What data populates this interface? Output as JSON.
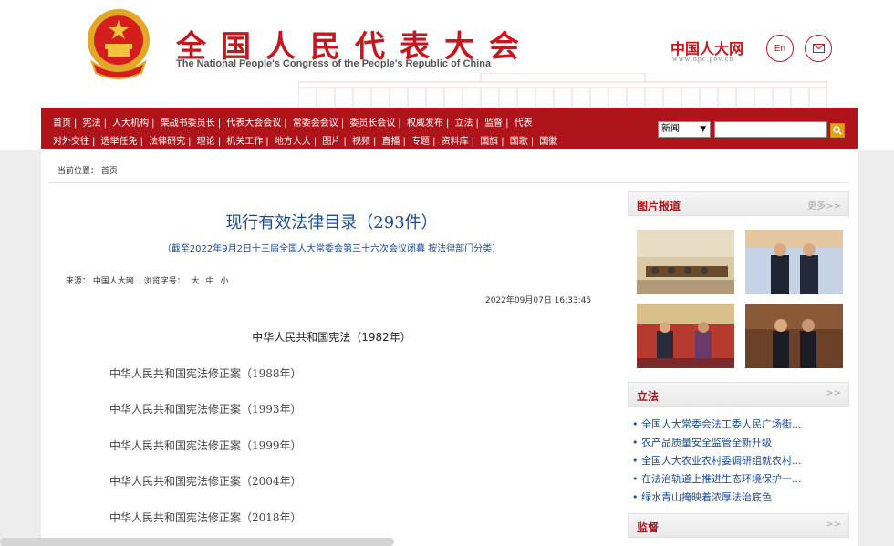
{
  "header": {
    "title_cn": "全国人民代表大会",
    "title_en": "The National People's Congress of the People's Republic of China",
    "npc_logo": "中国人大网",
    "npc_url": "www.npc.gov.cn",
    "en_button": "En",
    "mail_icon": "mail-icon"
  },
  "nav": {
    "row1": [
      "首页",
      "宪法",
      "人大机构",
      "栗战书委员长",
      "代表大会会议",
      "常委会会议",
      "委员长会议",
      "权威发布",
      "立法",
      "监督",
      "代表"
    ],
    "row2": [
      "对外交往",
      "选举任免",
      "法律研究",
      "理论",
      "机关工作",
      "地方人大",
      "图片",
      "视频",
      "直播",
      "专题",
      "资料库",
      "国旗",
      "国歌",
      "国徽"
    ],
    "search_select": "新闻",
    "search_placeholder": ""
  },
  "breadcrumb": {
    "label": "当前位置：",
    "home": "首页"
  },
  "article": {
    "title": "现行有效法律目录（293件）",
    "subtitle": "（截至2022年9月2日十三届全国人大常委会第三十六次会议闭幕 按法律部门分类）",
    "source_label": "来源：",
    "source": "中国人大网",
    "fontsize_label": "浏览字号：",
    "fs_large": "大",
    "fs_medium": "中",
    "fs_small": "小",
    "date": "2022年09月07日  16:33:45",
    "constitution": "中华人民共和国宪法（1982年）",
    "amendments": [
      "中华人民共和国宪法修正案（1988年）",
      "中华人民共和国宪法修正案（1993年）",
      "中华人民共和国宪法修正案（1999年）",
      "中华人民共和国宪法修正案（2004年）",
      "中华人民共和国宪法修正案（2018年）"
    ]
  },
  "sidebar": {
    "photos": {
      "title": "图片报道",
      "more": "更多>>"
    },
    "legislation": {
      "title": "立法",
      "more": ">>",
      "items": [
        "• 全国人大常委会法工委人民广场街...",
        "• 农产品质量安全监管全新升级",
        "• 全国人大农业农村委调研组就农村...",
        "• 在法治轨道上推进生态环境保护一...",
        "• 绿水青山掩映着浓厚法治底色"
      ]
    },
    "supervision": {
      "title": "监督",
      "more": ">>"
    }
  },
  "colors": {
    "brand_red": "#c8161d",
    "nav_red": "#b0141b",
    "link_blue": "#1a4aa0"
  }
}
